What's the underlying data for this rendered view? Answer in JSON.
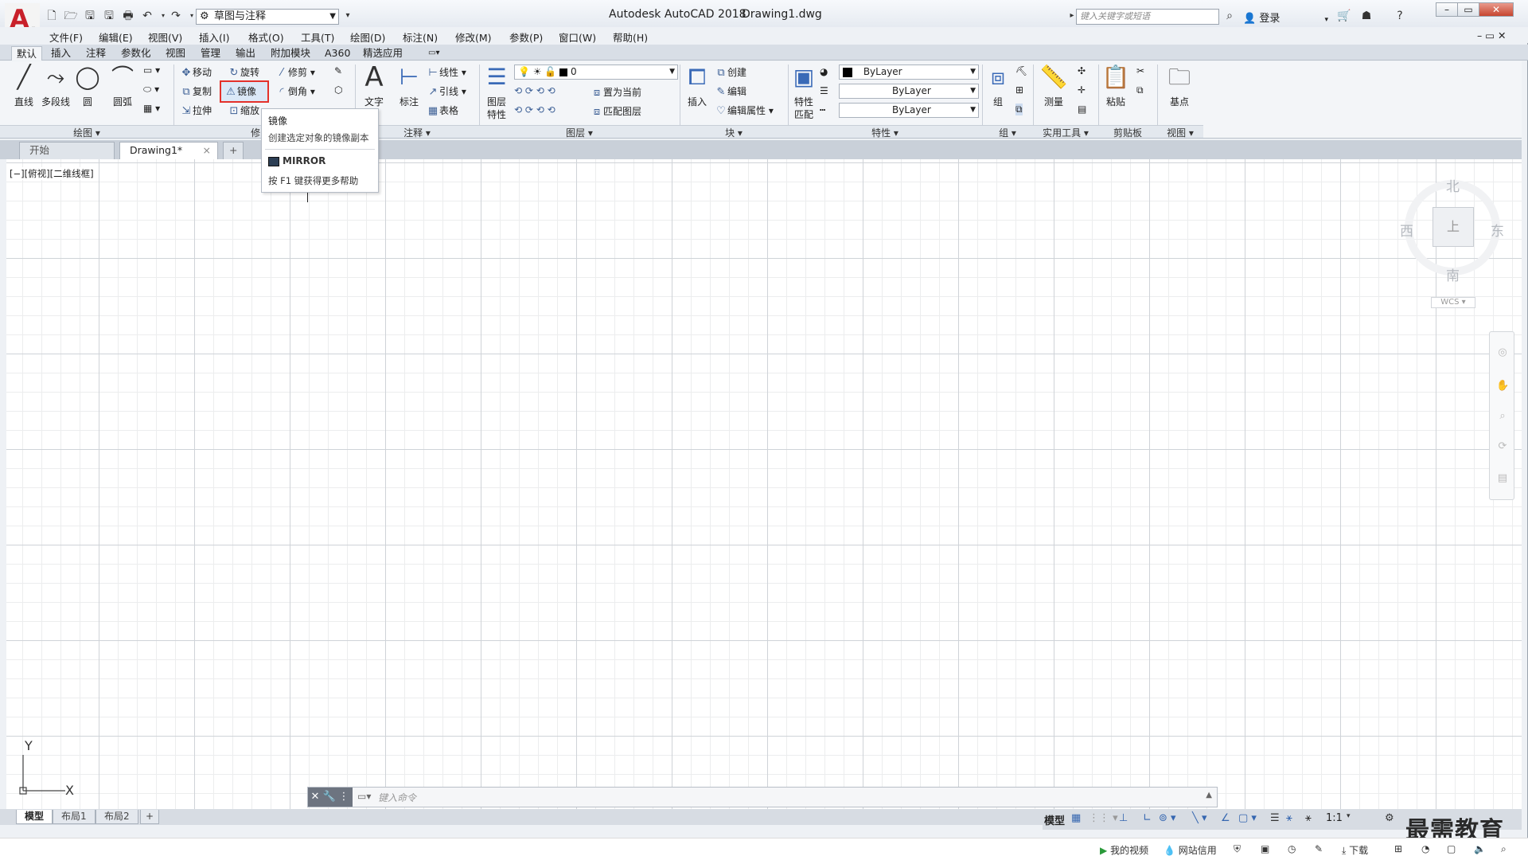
{
  "title_bar": {
    "app_title": "Autodesk AutoCAD 2018",
    "file_title": "Drawing1.dwg",
    "workspace": "草图与注释",
    "search_placeholder": "键入关键字或短语",
    "login_label": "登录"
  },
  "menu_bar": [
    "文件(F)",
    "编辑(E)",
    "视图(V)",
    "插入(I)",
    "格式(O)",
    "工具(T)",
    "绘图(D)",
    "标注(N)",
    "修改(M)",
    "参数(P)",
    "窗口(W)",
    "帮助(H)"
  ],
  "ribbon_tabs": [
    "默认",
    "插入",
    "注释",
    "参数化",
    "视图",
    "管理",
    "输出",
    "附加模块",
    "A360",
    "精选应用"
  ],
  "active_ribbon_tab": "默认",
  "draw_panel": {
    "title": "绘图",
    "line": "直线",
    "polyline": "多段线",
    "circle": "圆",
    "arc": "圆弧"
  },
  "modify_panel": {
    "title": "修改",
    "move": "移动",
    "rotate": "旋转",
    "trim": "修剪",
    "copy": "复制",
    "mirror": "镜像",
    "fillet": "倒角",
    "stretch": "拉伸",
    "scale": "缩放"
  },
  "annotation_panel": {
    "title": "注释",
    "text": "文字",
    "dimension": "标注",
    "linear": "线性",
    "leader": "引线",
    "table": "表格"
  },
  "layers_panel": {
    "title": "图层",
    "layer_properties": "图层\n特性",
    "layer_properties_1": "图层",
    "layer_properties_2": "特性",
    "current_layer": "0",
    "set_current": "置为当前",
    "match_layer": "匹配图层"
  },
  "block_panel": {
    "title": "块",
    "insert": "插入",
    "create": "创建",
    "edit": "编辑",
    "edit_attributes": "编辑属性"
  },
  "properties_panel": {
    "title": "特性",
    "match_1": "特性",
    "match_2": "匹配",
    "color": "ByLayer",
    "linetype": "ByLayer",
    "lineweight": "ByLayer"
  },
  "groups_panel": {
    "title": "组",
    "group": "组"
  },
  "utilities_panel": {
    "title": "实用工具",
    "measure": "测量"
  },
  "clipboard_panel": {
    "title": "剪贴板",
    "paste": "粘贴"
  },
  "view_panel": {
    "title": "视图",
    "base": "基点"
  },
  "doc_tabs": [
    "开始",
    "Drawing1*"
  ],
  "active_doc_tab": "Drawing1*",
  "viewport_label": "[−][俯视][二维线框]",
  "tooltip": {
    "title": "镜像",
    "description": "创建选定对象的镜像副本",
    "command": "MIRROR",
    "help": "按 F1 键获得更多帮助"
  },
  "view_cube": {
    "north": "北",
    "south": "南",
    "east": "东",
    "west": "西",
    "wcs": "WCS"
  },
  "ucs": {
    "x": "X",
    "y": "Y"
  },
  "command_line": {
    "placeholder": "键入命令"
  },
  "layout_tabs": [
    "模型",
    "布局1",
    "布局2"
  ],
  "active_layout_tab": "模型",
  "status_bar": {
    "model": "模型",
    "scale": "1:1"
  },
  "os_bar": {
    "video": "我的视频",
    "credit": "网站信用",
    "download": "下载"
  },
  "watermark": "最需教育",
  "colors": {
    "accent": "#3566b0",
    "highlight": "#e4312b",
    "logo": "#c8202a"
  }
}
